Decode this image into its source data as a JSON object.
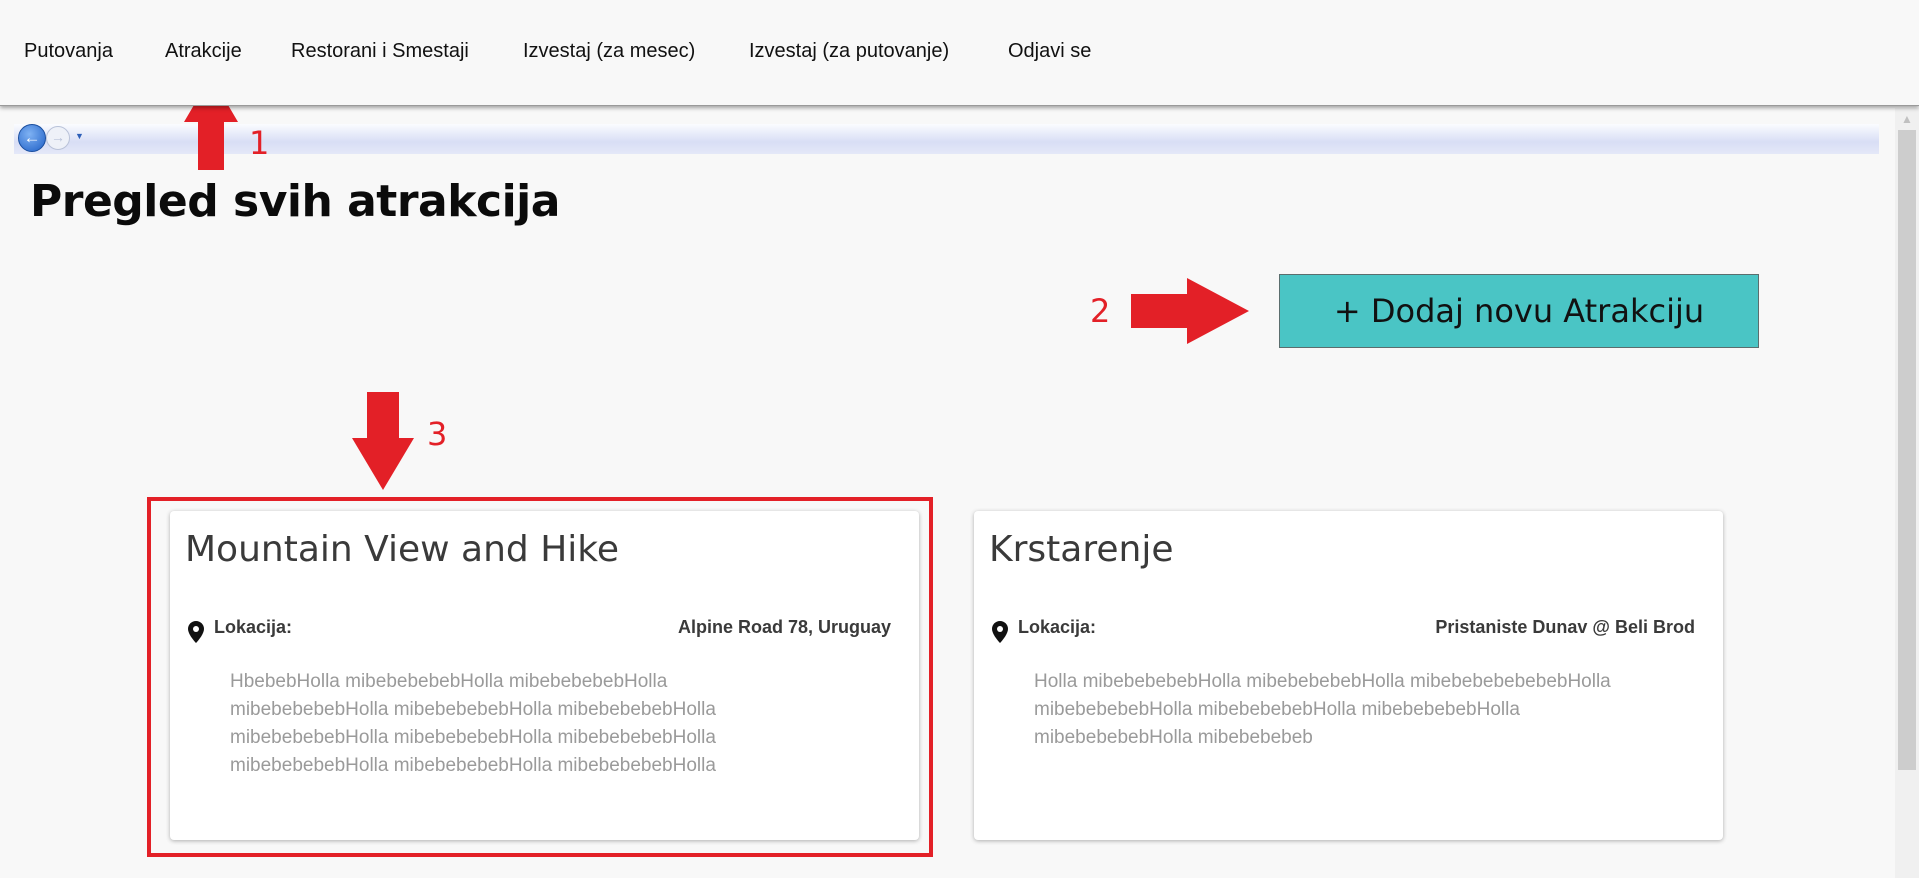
{
  "nav": {
    "items": [
      {
        "label": "Putovanja"
      },
      {
        "label": "Atrakcije"
      },
      {
        "label": "Restorani i Smestaji"
      },
      {
        "label": "Izvestaj (za mesec)"
      },
      {
        "label": "Izvestaj (za putovanje)"
      },
      {
        "label": "Odjavi se"
      }
    ]
  },
  "browser": {
    "back_icon": "back-arrow-icon",
    "forward_icon": "forward-arrow-icon",
    "dropdown_icon": "dropdown-triangle-icon"
  },
  "page": {
    "title": "Pregled svih atrakcija",
    "add_button_label": "+ Dodaj novu Atrakciju"
  },
  "cards": [
    {
      "title": "Mountain View and Hike",
      "location_label": "Lokacija:",
      "location_value": "Alpine Road 78, Uruguay",
      "description": "HbebebHolla mibebebebebHolla mibebebebebHolla mibebebebebHolla mibebebebebHolla mibebebebebHolla mibebebebebHolla mibebebebebHolla mibebebebebHolla mibebebebebHolla mibebebebebHolla mibebebebebHolla"
    },
    {
      "title": "Krstarenje",
      "location_label": "Lokacija:",
      "location_value": "Pristaniste Dunav @ Beli Brod",
      "description": "Holla mibebebebebHolla mibebebebebHolla mibebebebebebebHolla mibebebebebHolla mibebebebebHolla mibebebebebHolla mibebebebebHolla mibebebebeb"
    }
  ],
  "annotations": {
    "color": "#e32027",
    "labels": [
      "1",
      "2",
      "3"
    ]
  },
  "colors": {
    "add_button": "#4ac5c5",
    "annotation": "#e32027"
  }
}
